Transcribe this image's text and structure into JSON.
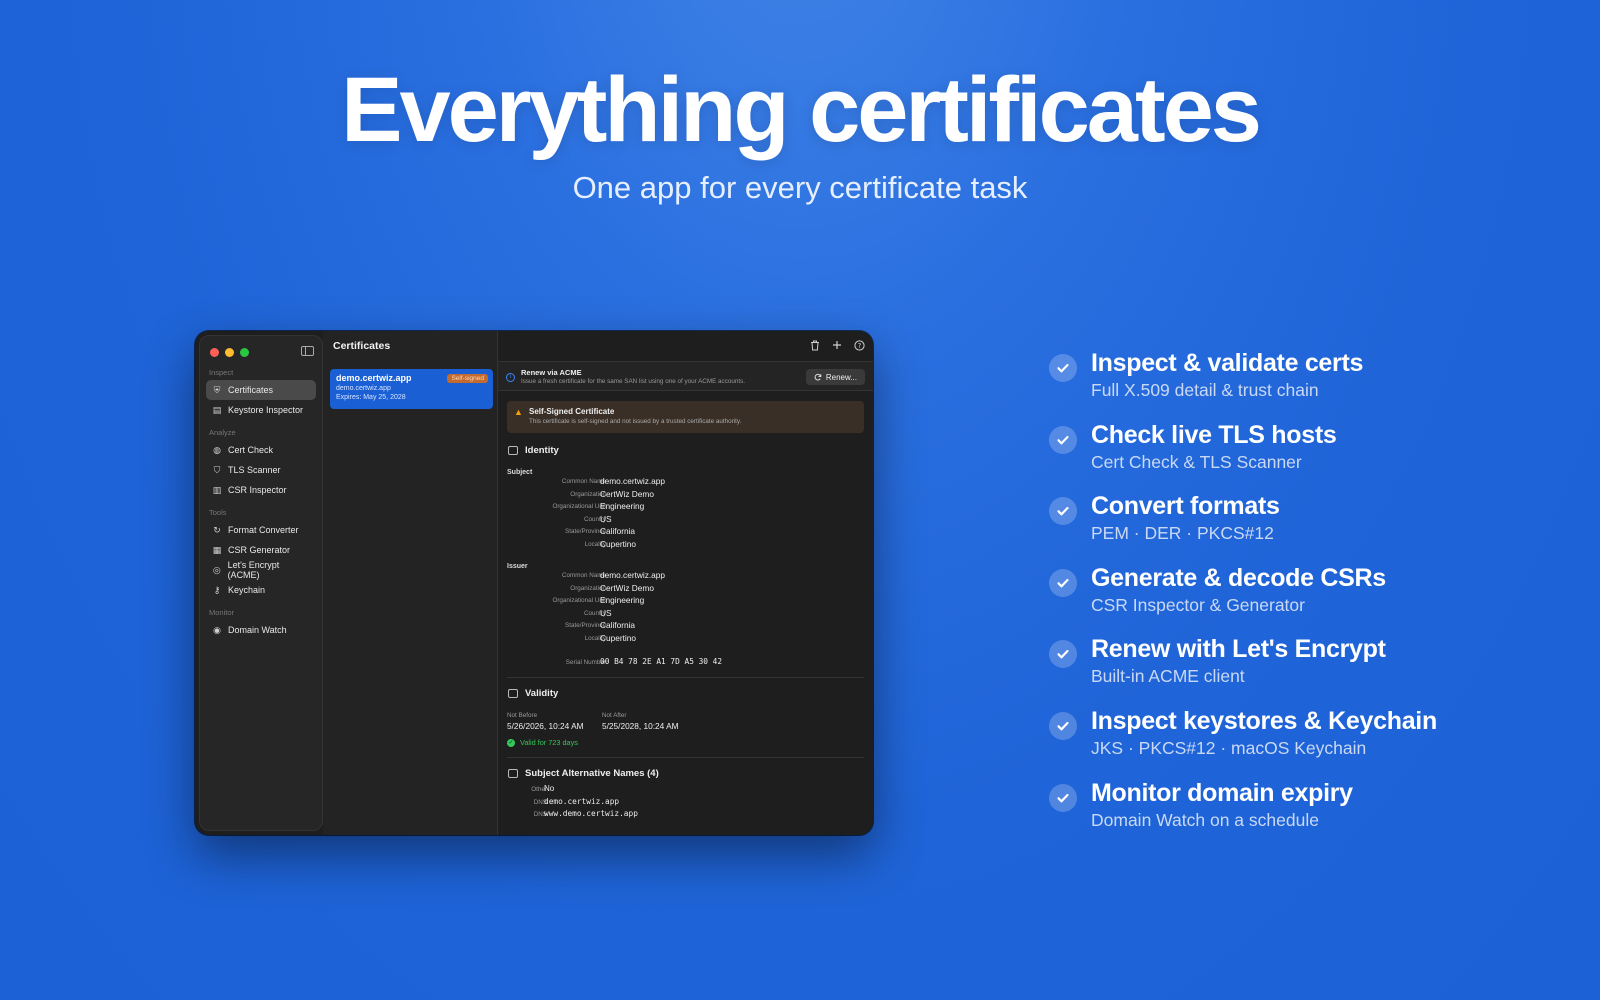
{
  "hero": {
    "title": "Everything certificates",
    "subtitle": "One app for every certificate task"
  },
  "app": {
    "sidebar": {
      "sections": [
        {
          "label": "Inspect",
          "items": [
            {
              "label": "Certificates",
              "icon": "shield-check-icon",
              "active": true
            },
            {
              "label": "Keystore Inspector",
              "icon": "doc-lock-icon"
            }
          ]
        },
        {
          "label": "Analyze",
          "items": [
            {
              "label": "Cert Check",
              "icon": "globe-icon"
            },
            {
              "label": "TLS Scanner",
              "icon": "shield-icon"
            },
            {
              "label": "CSR Inspector",
              "icon": "doc-icon"
            }
          ]
        },
        {
          "label": "Tools",
          "items": [
            {
              "label": "Format Converter",
              "icon": "refresh-icon"
            },
            {
              "label": "CSR Generator",
              "icon": "doc-plus-icon"
            },
            {
              "label": "Let's Encrypt (ACME)",
              "icon": "lock-icon"
            },
            {
              "label": "Keychain",
              "icon": "key-icon"
            }
          ]
        },
        {
          "label": "Monitor",
          "items": [
            {
              "label": "Domain Watch",
              "icon": "eye-icon"
            }
          ]
        }
      ]
    },
    "list": {
      "title": "Certificates",
      "cert": {
        "name": "demo.certwiz.app",
        "domain": "demo.certwiz.app",
        "expires": "Expires: May 25, 2028",
        "badge": "Self-signed"
      }
    },
    "detail": {
      "acme": {
        "title": "Renew via ACME",
        "desc": "Issue a fresh certificate for the same SAN list using one of your ACME accounts.",
        "button": "Renew..."
      },
      "warning": {
        "title": "Self-Signed Certificate",
        "desc": "This certificate is self-signed and not issued by a trusted certificate authority."
      },
      "identity": {
        "title": "Identity",
        "subject_label": "Subject",
        "subject": [
          {
            "k": "Common Name",
            "v": "demo.certwiz.app"
          },
          {
            "k": "Organization",
            "v": "CertWiz Demo"
          },
          {
            "k": "Organizational Unit",
            "v": "Engineering"
          },
          {
            "k": "Country",
            "v": "US"
          },
          {
            "k": "State/Province",
            "v": "California"
          },
          {
            "k": "Locality",
            "v": "Cupertino"
          }
        ],
        "issuer_label": "Issuer",
        "issuer": [
          {
            "k": "Common Name",
            "v": "demo.certwiz.app"
          },
          {
            "k": "Organization",
            "v": "CertWiz Demo"
          },
          {
            "k": "Organizational Unit",
            "v": "Engineering"
          },
          {
            "k": "Country",
            "v": "US"
          },
          {
            "k": "State/Province",
            "v": "California"
          },
          {
            "k": "Locality",
            "v": "Cupertino"
          }
        ],
        "serial_label": "Serial Number",
        "serial": "00 B4 78 2E A1 7D A5 30 42"
      },
      "validity": {
        "title": "Validity",
        "not_before_label": "Not Before",
        "not_before": "5/26/2026, 10:24 AM",
        "not_after_label": "Not After",
        "not_after": "5/25/2028, 10:24 AM",
        "status": "Valid for 723 days"
      },
      "san": {
        "title": "Subject Alternative Names (4)",
        "entries": [
          {
            "k": "Other",
            "v": "No"
          },
          {
            "k": "DNS",
            "v": "demo.certwiz.app"
          },
          {
            "k": "DNS",
            "v": "www.demo.certwiz.app"
          }
        ]
      }
    }
  },
  "features": [
    {
      "title": "Inspect & validate certs",
      "sub": "Full X.509 detail & trust chain"
    },
    {
      "title": "Check live TLS hosts",
      "sub": "Cert Check & TLS Scanner"
    },
    {
      "title": "Convert formats",
      "sub": "PEM · DER · PKCS#12"
    },
    {
      "title": "Generate & decode CSRs",
      "sub": "CSR Inspector & Generator"
    },
    {
      "title": "Renew with Let's Encrypt",
      "sub": "Built-in ACME client"
    },
    {
      "title": "Inspect keystores & Keychain",
      "sub": "JKS · PKCS#12 · macOS Keychain"
    },
    {
      "title": "Monitor domain expiry",
      "sub": "Domain Watch on a schedule"
    }
  ],
  "colors": {
    "accent": "#1a5fd4",
    "background": "#1f64d8",
    "warning": "#f59e0b",
    "success": "#34c759"
  }
}
